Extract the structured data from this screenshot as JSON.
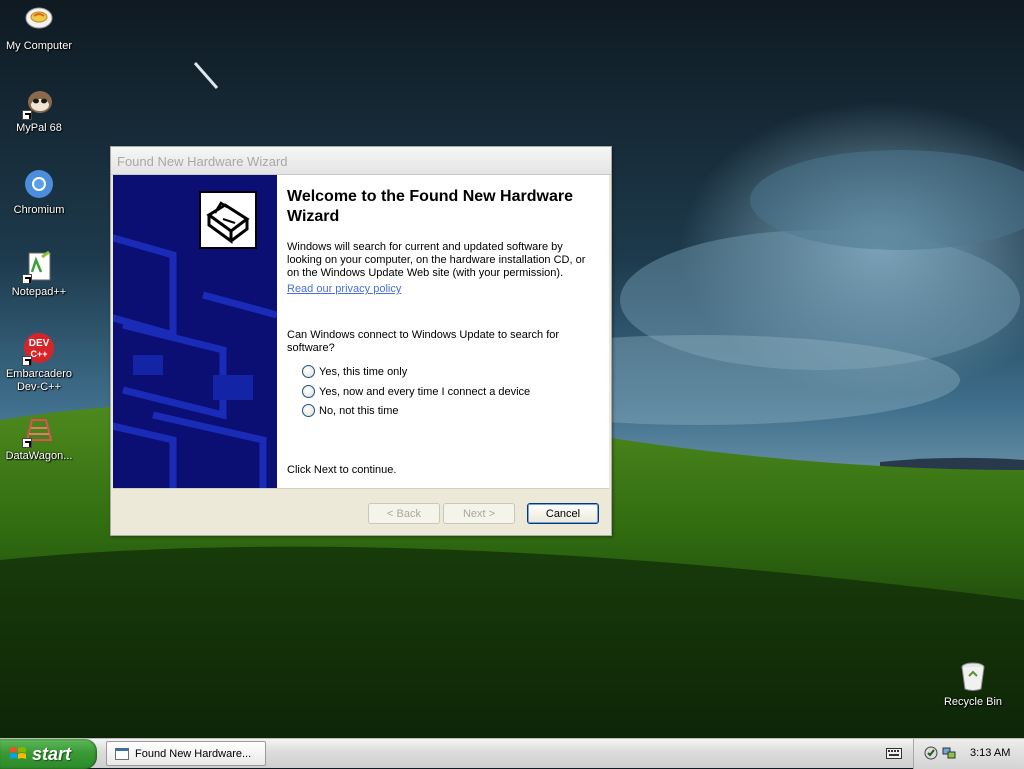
{
  "desktop": {
    "icons": [
      {
        "label": "My Computer",
        "icon": "my-computer-icon"
      },
      {
        "label": "MyPal 68",
        "icon": "mypal-icon"
      },
      {
        "label": "Chromium",
        "icon": "chromium-icon"
      },
      {
        "label": "Notepad++",
        "icon": "notepadpp-icon"
      },
      {
        "label": "Embarcadero Dev-C++",
        "line1": "Embarcadero",
        "line2": "Dev-C++",
        "icon": "devcpp-icon"
      },
      {
        "label": "DataWagon...",
        "icon": "datawagon-icon"
      },
      {
        "label": "Recycle Bin",
        "icon": "recycle-bin-icon"
      }
    ]
  },
  "wizard": {
    "title": "Found New Hardware Wizard",
    "heading": "Welcome to the Found New Hardware Wizard",
    "intro": "Windows will search for current and updated software by looking on your computer, on the hardware installation CD, or on the Windows Update Web site (with your permission).",
    "privacy_link": "Read our privacy policy",
    "question": "Can Windows connect to Windows Update to search for software?",
    "options": [
      "Yes, this time only",
      "Yes, now and every time I connect a device",
      "No, not this time"
    ],
    "continue_text": "Click Next to continue.",
    "buttons": {
      "back": "< Back",
      "next": "Next >",
      "cancel": "Cancel"
    }
  },
  "taskbar": {
    "start_label": "start",
    "task_item": "Found New Hardware...",
    "clock": "3:13 AM"
  },
  "colors": {
    "wizard_side": "#0b0f74",
    "start_green": "#3a9a36",
    "link": "#4a6ed8"
  }
}
